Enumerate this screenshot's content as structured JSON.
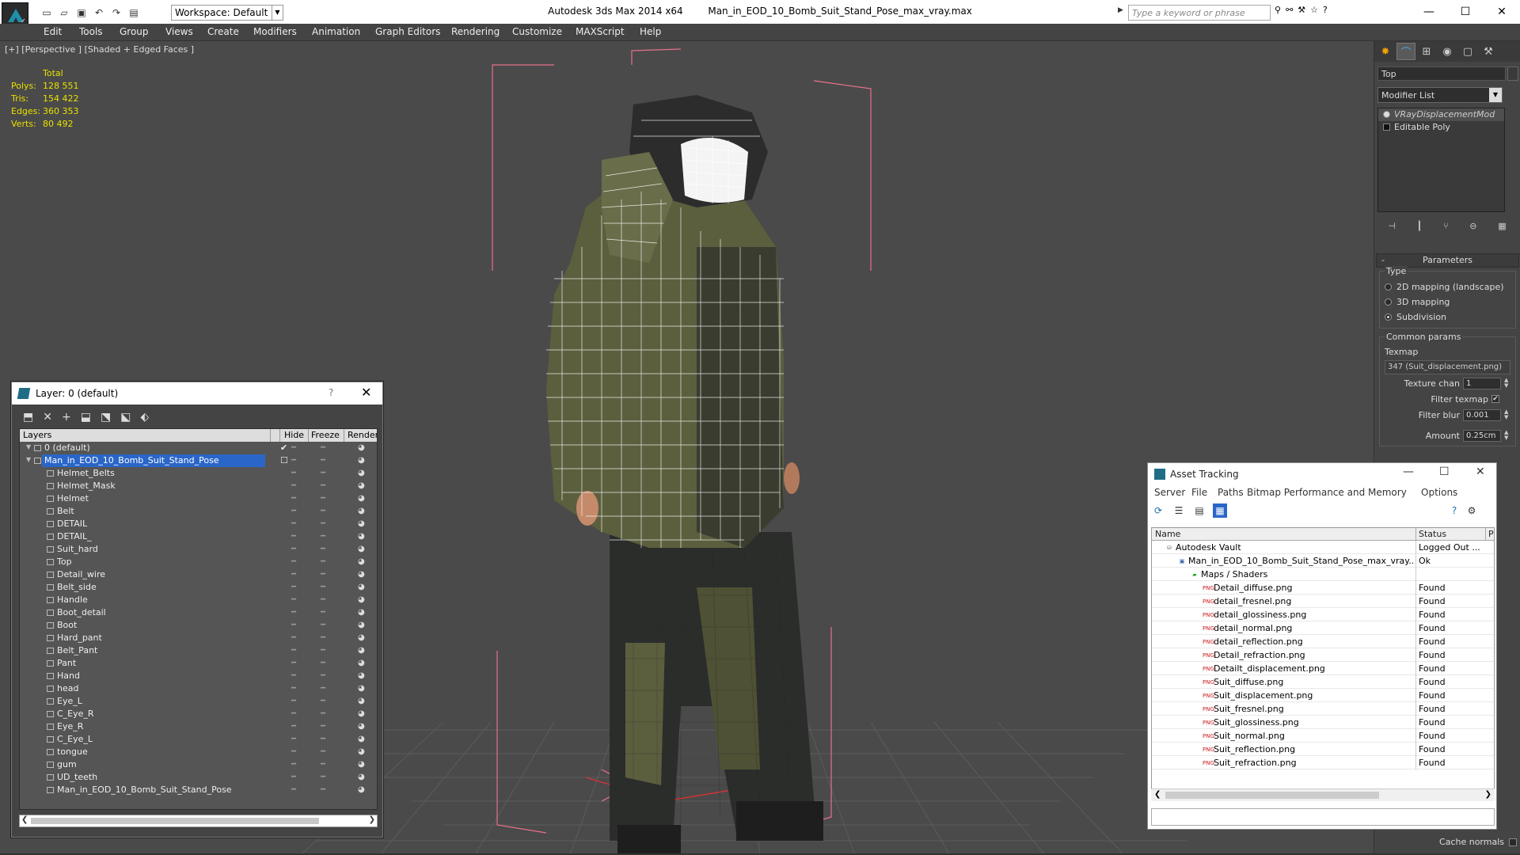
{
  "app": {
    "title_app": "Autodesk 3ds Max  2014 x64",
    "title_file": "Man_in_EOD_10_Bomb_Suit_Stand_Pose_max_vray.max",
    "workspace": "Workspace: Default",
    "search_placeholder": "Type a keyword or phrase"
  },
  "menu": [
    "Edit",
    "Tools",
    "Group",
    "Views",
    "Create",
    "Modifiers",
    "Animation",
    "Graph Editors",
    "Rendering",
    "Customize",
    "MAXScript",
    "Help"
  ],
  "viewport": {
    "label": "[+] [Perspective ] [Shaded + Edged Faces ]",
    "stats_header": "Total",
    "stats": [
      {
        "k": "Polys:",
        "v": "128 551"
      },
      {
        "k": "Tris:",
        "v": "154 422"
      },
      {
        "k": "Edges:",
        "v": "360 353"
      },
      {
        "k": "Verts:",
        "v": "80 492"
      }
    ]
  },
  "command_panel": {
    "object_name": "Top",
    "modifier_list": "Modifier List",
    "stack": [
      {
        "label": "VRayDisplacementMod",
        "selected": true
      },
      {
        "label": "Editable Poly",
        "selected": false
      }
    ],
    "params_title": "Parameters",
    "type_group": "Type",
    "type_options": [
      {
        "label": "2D mapping (landscape)",
        "on": false
      },
      {
        "label": "3D mapping",
        "on": false
      },
      {
        "label": "Subdivision",
        "on": true
      }
    ],
    "common_group": "Common params",
    "texmap_label": "Texmap",
    "texmap_value": "347 (Suit_displacement.png)",
    "texture_chan_label": "Texture chan",
    "texture_chan_value": "1",
    "filter_texmap_label": "Filter texmap",
    "filter_blur_label": "Filter blur",
    "filter_blur_value": "0.001",
    "amount_label": "Amount",
    "amount_value": "0.25cm",
    "cache_normals_label": "Cache normals"
  },
  "layer_panel": {
    "title": "Layer: 0 (default)",
    "help": "?",
    "columns": {
      "layers": "Layers",
      "hide": "Hide",
      "freeze": "Freeze",
      "render": "Render"
    },
    "rows": [
      {
        "name": "0 (default)",
        "level": 0,
        "current": true,
        "selected": false
      },
      {
        "name": "Man_in_EOD_10_Bomb_Suit_Stand_Pose",
        "level": 0,
        "current": false,
        "selected": true
      },
      {
        "name": "Helmet_Belts",
        "level": 1
      },
      {
        "name": "Helmet_Mask",
        "level": 1
      },
      {
        "name": "Helmet",
        "level": 1
      },
      {
        "name": "Belt",
        "level": 1
      },
      {
        "name": "DETAIL",
        "level": 1
      },
      {
        "name": "DETAIL_",
        "level": 1
      },
      {
        "name": "Suit_hard",
        "level": 1
      },
      {
        "name": "Top",
        "level": 1
      },
      {
        "name": "Detail_wire",
        "level": 1
      },
      {
        "name": "Belt_side",
        "level": 1
      },
      {
        "name": "Handle",
        "level": 1
      },
      {
        "name": "Boot_detail",
        "level": 1
      },
      {
        "name": "Boot",
        "level": 1
      },
      {
        "name": "Hard_pant",
        "level": 1
      },
      {
        "name": "Belt_Pant",
        "level": 1
      },
      {
        "name": "Pant",
        "level": 1
      },
      {
        "name": "Hand",
        "level": 1
      },
      {
        "name": "head",
        "level": 1
      },
      {
        "name": "Eye_L",
        "level": 1
      },
      {
        "name": "C_Eye_R",
        "level": 1
      },
      {
        "name": "Eye_R",
        "level": 1
      },
      {
        "name": "C_Eye_L",
        "level": 1
      },
      {
        "name": "tongue",
        "level": 1
      },
      {
        "name": "gum",
        "level": 1
      },
      {
        "name": "UD_teeth",
        "level": 1
      },
      {
        "name": "Man_in_EOD_10_Bomb_Suit_Stand_Pose",
        "level": 1
      }
    ]
  },
  "asset_tracking": {
    "title": "Asset Tracking",
    "menu": [
      "Server",
      "File",
      "Paths",
      "Bitmap Performance and Memory",
      "Options"
    ],
    "columns": {
      "name": "Name",
      "status": "Status",
      "extra": "P"
    },
    "rows": [
      {
        "name": "Autodesk Vault",
        "status": "Logged Out ...",
        "level": 0,
        "icon": "vault"
      },
      {
        "name": "Man_in_EOD_10_Bomb_Suit_Stand_Pose_max_vray....",
        "status": "Ok",
        "level": 1,
        "icon": "max"
      },
      {
        "name": "Maps / Shaders",
        "status": "",
        "level": 2,
        "icon": "maps"
      },
      {
        "name": "Detail_diffuse.png",
        "status": "Found",
        "level": 3,
        "icon": "png"
      },
      {
        "name": "detail_fresnel.png",
        "status": "Found",
        "level": 3,
        "icon": "png"
      },
      {
        "name": "detail_glossiness.png",
        "status": "Found",
        "level": 3,
        "icon": "png"
      },
      {
        "name": "detail_normal.png",
        "status": "Found",
        "level": 3,
        "icon": "png"
      },
      {
        "name": "detail_reflection.png",
        "status": "Found",
        "level": 3,
        "icon": "png"
      },
      {
        "name": "Detail_refraction.png",
        "status": "Found",
        "level": 3,
        "icon": "png"
      },
      {
        "name": "Detailt_displacement.png",
        "status": "Found",
        "level": 3,
        "icon": "png"
      },
      {
        "name": "Suit_diffuse.png",
        "status": "Found",
        "level": 3,
        "icon": "png"
      },
      {
        "name": "Suit_displacement.png",
        "status": "Found",
        "level": 3,
        "icon": "png"
      },
      {
        "name": "Suit_fresnel.png",
        "status": "Found",
        "level": 3,
        "icon": "png"
      },
      {
        "name": "Suit_glossiness.png",
        "status": "Found",
        "level": 3,
        "icon": "png"
      },
      {
        "name": "Suit_normal.png",
        "status": "Found",
        "level": 3,
        "icon": "png"
      },
      {
        "name": "Suit_reflection.png",
        "status": "Found",
        "level": 3,
        "icon": "png"
      },
      {
        "name": "Suit_refraction.png",
        "status": "Found",
        "level": 3,
        "icon": "png"
      }
    ]
  },
  "colors": {
    "stats_yellow": "#e8e000",
    "selection_blue": "#2a66c8",
    "bbox_pink": "#e8708a",
    "suit_olive": "#5c5f3e"
  }
}
